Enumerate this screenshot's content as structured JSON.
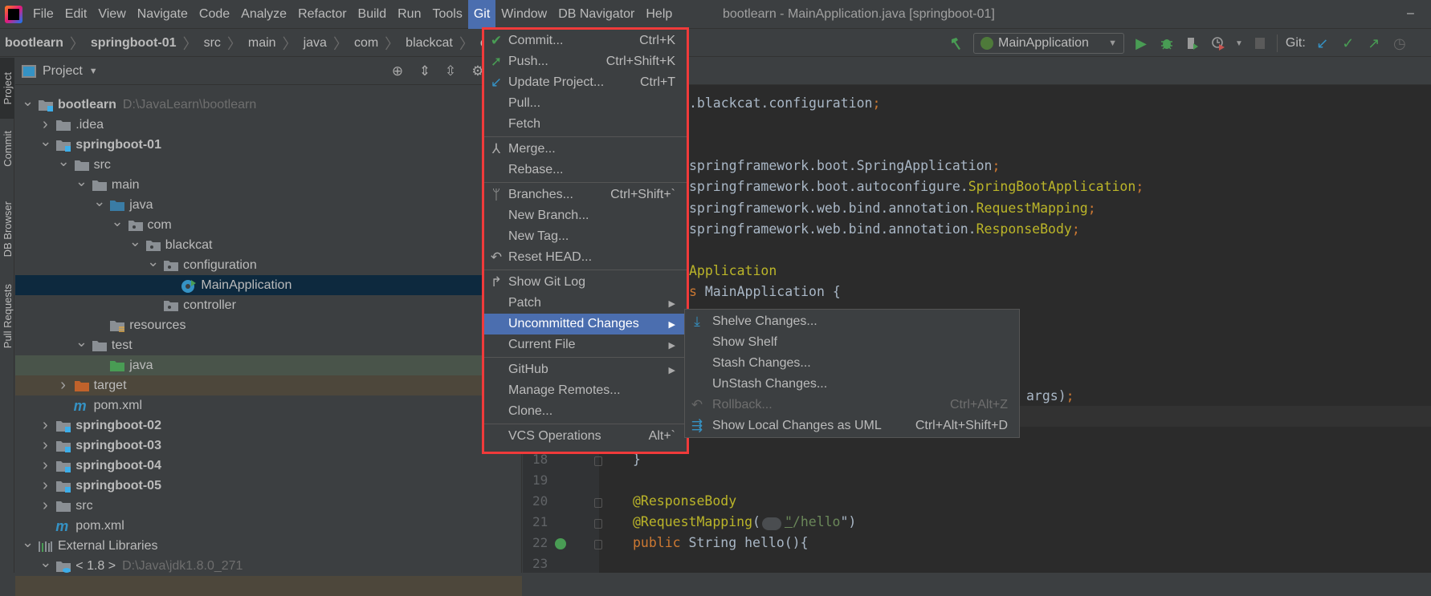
{
  "menubar": {
    "items": [
      "File",
      "Edit",
      "View",
      "Navigate",
      "Code",
      "Analyze",
      "Refactor",
      "Build",
      "Run",
      "Tools",
      "Git",
      "Window",
      "DB Navigator",
      "Help"
    ],
    "active": "Git"
  },
  "window_title": "bootlearn - MainApplication.java [springboot-01]",
  "window_controls": {
    "minimize": "–"
  },
  "breadcrumb": [
    {
      "label": "bootlearn",
      "bold": true
    },
    {
      "label": "springboot-01",
      "bold": true
    },
    {
      "label": "src"
    },
    {
      "label": "main"
    },
    {
      "label": "java"
    },
    {
      "label": "com"
    },
    {
      "label": "blackcat"
    },
    {
      "label": "configuratio"
    }
  ],
  "toolbar": {
    "run_config": "MainApplication",
    "git_label": "Git:"
  },
  "tool_strip": [
    "Project",
    "Commit",
    "DB Browser",
    "Pull Requests"
  ],
  "project": {
    "title": "Project",
    "tree": [
      {
        "label": "bootlearn",
        "level": 0,
        "expand": "open",
        "icon": "module-folder",
        "bold": true,
        "hint": "D:\\JavaLearn\\bootlearn"
      },
      {
        "label": ".idea",
        "level": 1,
        "expand": "closed",
        "icon": "folder"
      },
      {
        "label": "springboot-01",
        "level": 1,
        "expand": "open",
        "icon": "module-folder",
        "bold": true
      },
      {
        "label": "src",
        "level": 2,
        "expand": "open",
        "icon": "folder"
      },
      {
        "label": "main",
        "level": 3,
        "expand": "open",
        "icon": "folder"
      },
      {
        "label": "java",
        "level": 4,
        "expand": "open",
        "icon": "source-folder"
      },
      {
        "label": "com",
        "level": 5,
        "expand": "open",
        "icon": "package"
      },
      {
        "label": "blackcat",
        "level": 6,
        "expand": "open",
        "icon": "package"
      },
      {
        "label": "configuration",
        "level": 7,
        "expand": "open",
        "icon": "package"
      },
      {
        "label": "MainApplication",
        "level": 8,
        "expand": "none",
        "icon": "spring-boot-class",
        "state": "selected"
      },
      {
        "label": "controller",
        "level": 7,
        "expand": "none",
        "icon": "package"
      },
      {
        "label": "resources",
        "level": 4,
        "expand": "none",
        "icon": "resources-folder"
      },
      {
        "label": "test",
        "level": 3,
        "expand": "open",
        "icon": "folder"
      },
      {
        "label": "java",
        "level": 4,
        "expand": "none",
        "icon": "test-folder",
        "state": "test"
      },
      {
        "label": "target",
        "level": 2,
        "expand": "closed",
        "icon": "excluded-folder",
        "state": "excluded"
      },
      {
        "label": "pom.xml",
        "level": 2,
        "expand": "none",
        "icon": "maven"
      },
      {
        "label": "springboot-02",
        "level": 1,
        "expand": "closed",
        "icon": "module-folder",
        "bold": true
      },
      {
        "label": "springboot-03",
        "level": 1,
        "expand": "closed",
        "icon": "module-folder",
        "bold": true
      },
      {
        "label": "springboot-04",
        "level": 1,
        "expand": "closed",
        "icon": "module-folder",
        "bold": true
      },
      {
        "label": "springboot-05",
        "level": 1,
        "expand": "closed",
        "icon": "module-folder",
        "bold": true
      },
      {
        "label": "src",
        "level": 1,
        "expand": "closed",
        "icon": "folder"
      },
      {
        "label": "pom.xml",
        "level": 1,
        "expand": "none",
        "icon": "maven"
      },
      {
        "label": "External Libraries",
        "level": 0,
        "expand": "open",
        "icon": "libraries"
      },
      {
        "label": "< 1.8 >",
        "level": 1,
        "expand": "open",
        "icon": "jdk",
        "hint": "D:\\Java\\jdk1.8.0_271"
      }
    ]
  },
  "editor": {
    "line_numbers": [
      "18",
      "19",
      "20",
      "21",
      "22",
      "23"
    ],
    "visible_code": {
      "line1": ".blackcat.configuration",
      "line1_end": ";",
      "imports": [
        {
          "plain": "springframework.boot.SpringApplication",
          "cls": "",
          "end": ";"
        },
        {
          "plain": "springframework.boot.autoconfigure.",
          "cls": "SpringBootApplication",
          "end": ";"
        },
        {
          "plain": "springframework.web.bind.annotation.",
          "cls": "RequestMapping",
          "end": ";"
        },
        {
          "plain": "springframework.web.bind.annotation.",
          "cls": "ResponseBody",
          "end": ";"
        }
      ],
      "annotation_tail": "Application",
      "class_kw_tail": "s",
      "class_decl": " MainApplication {",
      "run_tail": "args)",
      "run_end": ";",
      "line18": "}",
      "line20": "@ResponseBody",
      "line21_ann": "@RequestMapping",
      "line21_open": "(",
      "line21_q1": "\"",
      "line21_str": "/hello",
      "line21_q2": "\")",
      "line22_kw": "public",
      "line22_rest": " String hello(){"
    }
  },
  "git_menu": [
    {
      "label": "Commit...",
      "shortcut": "Ctrl+K",
      "icon": "check-icon"
    },
    {
      "label": "Push...",
      "shortcut": "Ctrl+Shift+K",
      "icon": "push-arrow-icon"
    },
    {
      "label": "Update Project...",
      "shortcut": "Ctrl+T",
      "icon": "update-arrow-icon"
    },
    {
      "label": "Pull..."
    },
    {
      "label": "Fetch"
    },
    {
      "sep": true
    },
    {
      "label": "Merge...",
      "icon": "merge-icon"
    },
    {
      "label": "Rebase..."
    },
    {
      "sep": true
    },
    {
      "label": "Branches...",
      "shortcut": "Ctrl+Shift+`",
      "icon": "branch-icon"
    },
    {
      "label": "New Branch..."
    },
    {
      "label": "New Tag..."
    },
    {
      "label": "Reset HEAD...",
      "icon": "undo-icon"
    },
    {
      "sep": true
    },
    {
      "label": "Show Git Log",
      "icon": "git-log-icon"
    },
    {
      "label": "Patch",
      "submenu": true
    },
    {
      "label": "Uncommitted Changes",
      "submenu": true,
      "highlighted": true
    },
    {
      "label": "Current File",
      "submenu": true
    },
    {
      "sep": true
    },
    {
      "label": "GitHub",
      "submenu": true
    },
    {
      "label": "Manage Remotes..."
    },
    {
      "label": "Clone..."
    },
    {
      "sep": true
    },
    {
      "label": "VCS Operations",
      "shortcut": "Alt+`"
    }
  ],
  "uncommitted_submenu": [
    {
      "label": "Shelve Changes...",
      "icon": "shelve-icon"
    },
    {
      "label": "Show Shelf"
    },
    {
      "label": "Stash Changes..."
    },
    {
      "label": "UnStash Changes..."
    },
    {
      "label": "Rollback...",
      "shortcut": "Ctrl+Alt+Z",
      "icon": "rollback-icon",
      "disabled": true
    },
    {
      "label": "Show Local Changes as UML",
      "shortcut": "Ctrl+Alt+Shift+D",
      "icon": "uml-icon"
    }
  ],
  "colors": {
    "highlight": "#4b6eaf",
    "annotation_box": "#f03a3a",
    "selection": "#0d293e",
    "green": "#499c54",
    "blue": "#3592c4"
  }
}
